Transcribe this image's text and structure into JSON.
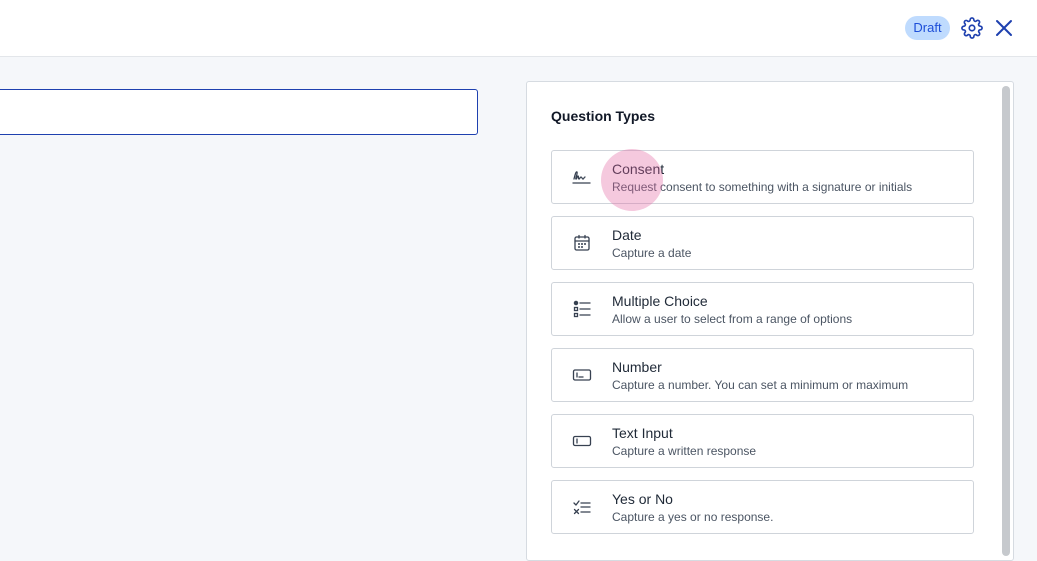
{
  "header": {
    "status_badge": "Draft",
    "settings_icon": "gear-icon",
    "close_icon": "close-icon"
  },
  "editor": {
    "title_value": "",
    "title_placeholder": ""
  },
  "panel": {
    "title": "Question Types",
    "items": [
      {
        "name": "Consent",
        "description": "Request consent to something with a signature or initials",
        "icon": "signature-icon"
      },
      {
        "name": "Date",
        "description": "Capture a date",
        "icon": "calendar-icon"
      },
      {
        "name": "Multiple Choice",
        "description": "Allow a user to select from a range of options",
        "icon": "list-options-icon"
      },
      {
        "name": "Number",
        "description": "Capture a number. You can set a minimum or maximum",
        "icon": "number-input-icon"
      },
      {
        "name": "Text Input",
        "description": "Capture a written response",
        "icon": "text-input-icon"
      },
      {
        "name": "Yes or No",
        "description": "Capture a yes or no response.",
        "icon": "yes-no-icon"
      }
    ]
  },
  "colors": {
    "accent": "#1e40af",
    "badge_bg": "#bfdbfe",
    "badge_text": "#1d4ed8",
    "background": "#f5f7fa"
  }
}
